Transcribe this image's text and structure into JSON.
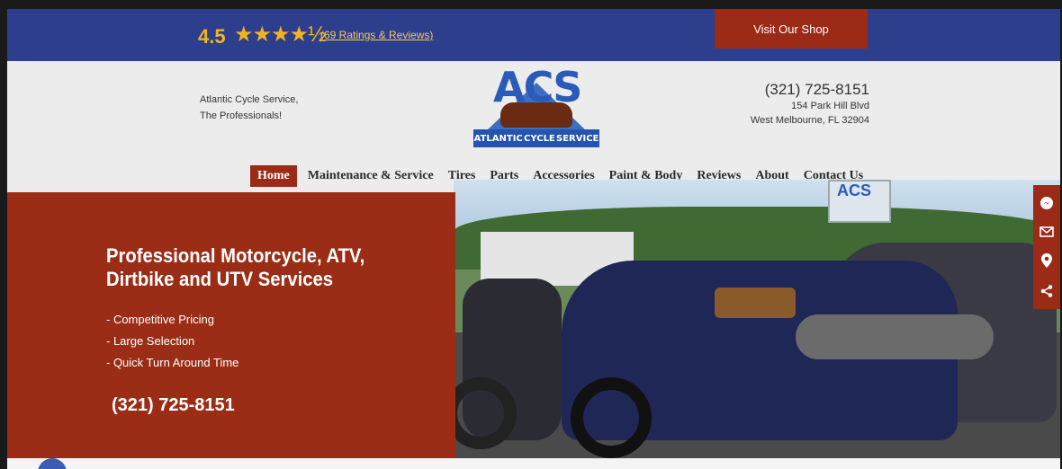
{
  "topbar": {
    "rating": "4.5",
    "stars": "★★★★½",
    "reviews_link": "(69 Ratings & Reviews)",
    "shop_button": "Visit Our Shop"
  },
  "header": {
    "tagline_line1": "Atlantic Cycle Service,",
    "tagline_line2": "The Professionals!",
    "logo_text": "ACS",
    "logo_band": [
      "ATLANTIC",
      "CYCLE",
      "SERVICE"
    ],
    "phone": "(321) 725-8151",
    "address_line1": "154 Park Hill Blvd",
    "address_line2": "West Melbourne, FL 32904"
  },
  "nav": {
    "items": [
      "Home",
      "Maintenance & Service",
      "Tires",
      "Parts",
      "Accessories",
      "Paint & Body",
      "Reviews",
      "About",
      "Contact Us"
    ],
    "active": "Home"
  },
  "hero": {
    "title_line1": "Professional Motorcycle, ATV,",
    "title_line2": "Dirtbike and UTV Services",
    "bullets": [
      "- Competitive Pricing",
      "- Large Selection",
      "- Quick Turn Around Time"
    ],
    "phone": "(321) 725-8151",
    "photo_sign_text": "ACS"
  },
  "sidebar": {
    "icons": [
      "messenger-icon",
      "email-icon",
      "location-pin-icon",
      "share-icon"
    ]
  },
  "colors": {
    "topbar": "#2d3f8c",
    "accent_red": "#9b2a17",
    "star_gold": "#f2b323"
  }
}
